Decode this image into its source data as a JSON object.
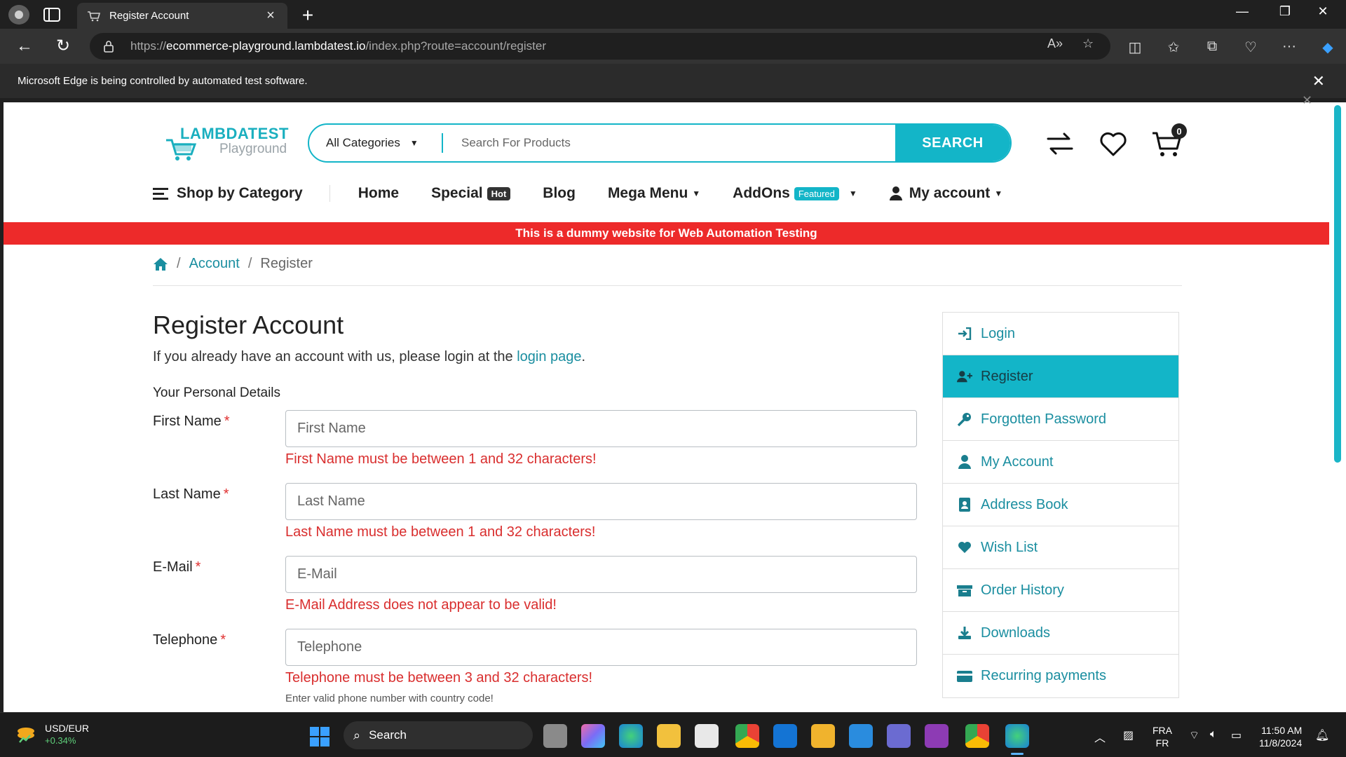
{
  "browser": {
    "tab_title": "Register Account",
    "url_prefix": "https://",
    "url_host": "ecommerce-playground.lambdatest.io",
    "url_path": "/index.php?route=account/register",
    "infobar_text": "Microsoft Edge is being controlled by automated test software."
  },
  "header": {
    "logo_line1": "LAMBDATEST",
    "logo_line2": "Playground",
    "category_label": "All Categories",
    "search_placeholder": "Search For Products",
    "search_button": "SEARCH",
    "cart_count": "0"
  },
  "nav": {
    "shop_by_category": "Shop by Category",
    "home": "Home",
    "special": "Special",
    "special_badge": "Hot",
    "blog": "Blog",
    "mega_menu": "Mega Menu",
    "addons": "AddOns",
    "addons_badge": "Featured",
    "my_account": "My account"
  },
  "notice": "This is a dummy website for Web Automation Testing",
  "breadcrumb": {
    "account": "Account",
    "register": "Register"
  },
  "form": {
    "title": "Register Account",
    "intro_before": "If you already have an account with us, please login at the ",
    "intro_link": "login page",
    "intro_after": ".",
    "legend": "Your Personal Details",
    "fields": [
      {
        "label": "First Name",
        "placeholder": "First Name",
        "error": "First Name must be between 1 and 32 characters!"
      },
      {
        "label": "Last Name",
        "placeholder": "Last Name",
        "error": "Last Name must be between 1 and 32 characters!"
      },
      {
        "label": "E-Mail",
        "placeholder": "E-Mail",
        "error": "E-Mail Address does not appear to be valid!"
      },
      {
        "label": "Telephone",
        "placeholder": "Telephone",
        "error": "Telephone must be between 3 and 32 characters!",
        "help": "Enter valid phone number with country code!"
      }
    ],
    "required_mark": "*"
  },
  "sidebar": {
    "items": [
      {
        "label": "Login",
        "icon": "sign-in-icon"
      },
      {
        "label": "Register",
        "icon": "user-plus-icon",
        "active": true
      },
      {
        "label": "Forgotten Password",
        "icon": "key-icon"
      },
      {
        "label": "My Account",
        "icon": "user-icon"
      },
      {
        "label": "Address Book",
        "icon": "address-book-icon"
      },
      {
        "label": "Wish List",
        "icon": "heart-icon"
      },
      {
        "label": "Order History",
        "icon": "box-icon"
      },
      {
        "label": "Downloads",
        "icon": "download-icon"
      },
      {
        "label": "Recurring payments",
        "icon": "credit-card-icon"
      }
    ]
  },
  "taskbar": {
    "ticker_name": "USD/EUR",
    "ticker_change": "+0.34%",
    "search_label": "Search",
    "lang_line1": "FRA",
    "lang_line2": "FR",
    "time": "11:50 AM",
    "date": "11/8/2024"
  },
  "colors": {
    "accent": "#13b5c8",
    "notice_red": "#ed2a2a",
    "error_red": "#d92e2e",
    "link": "#1a8ea0"
  }
}
